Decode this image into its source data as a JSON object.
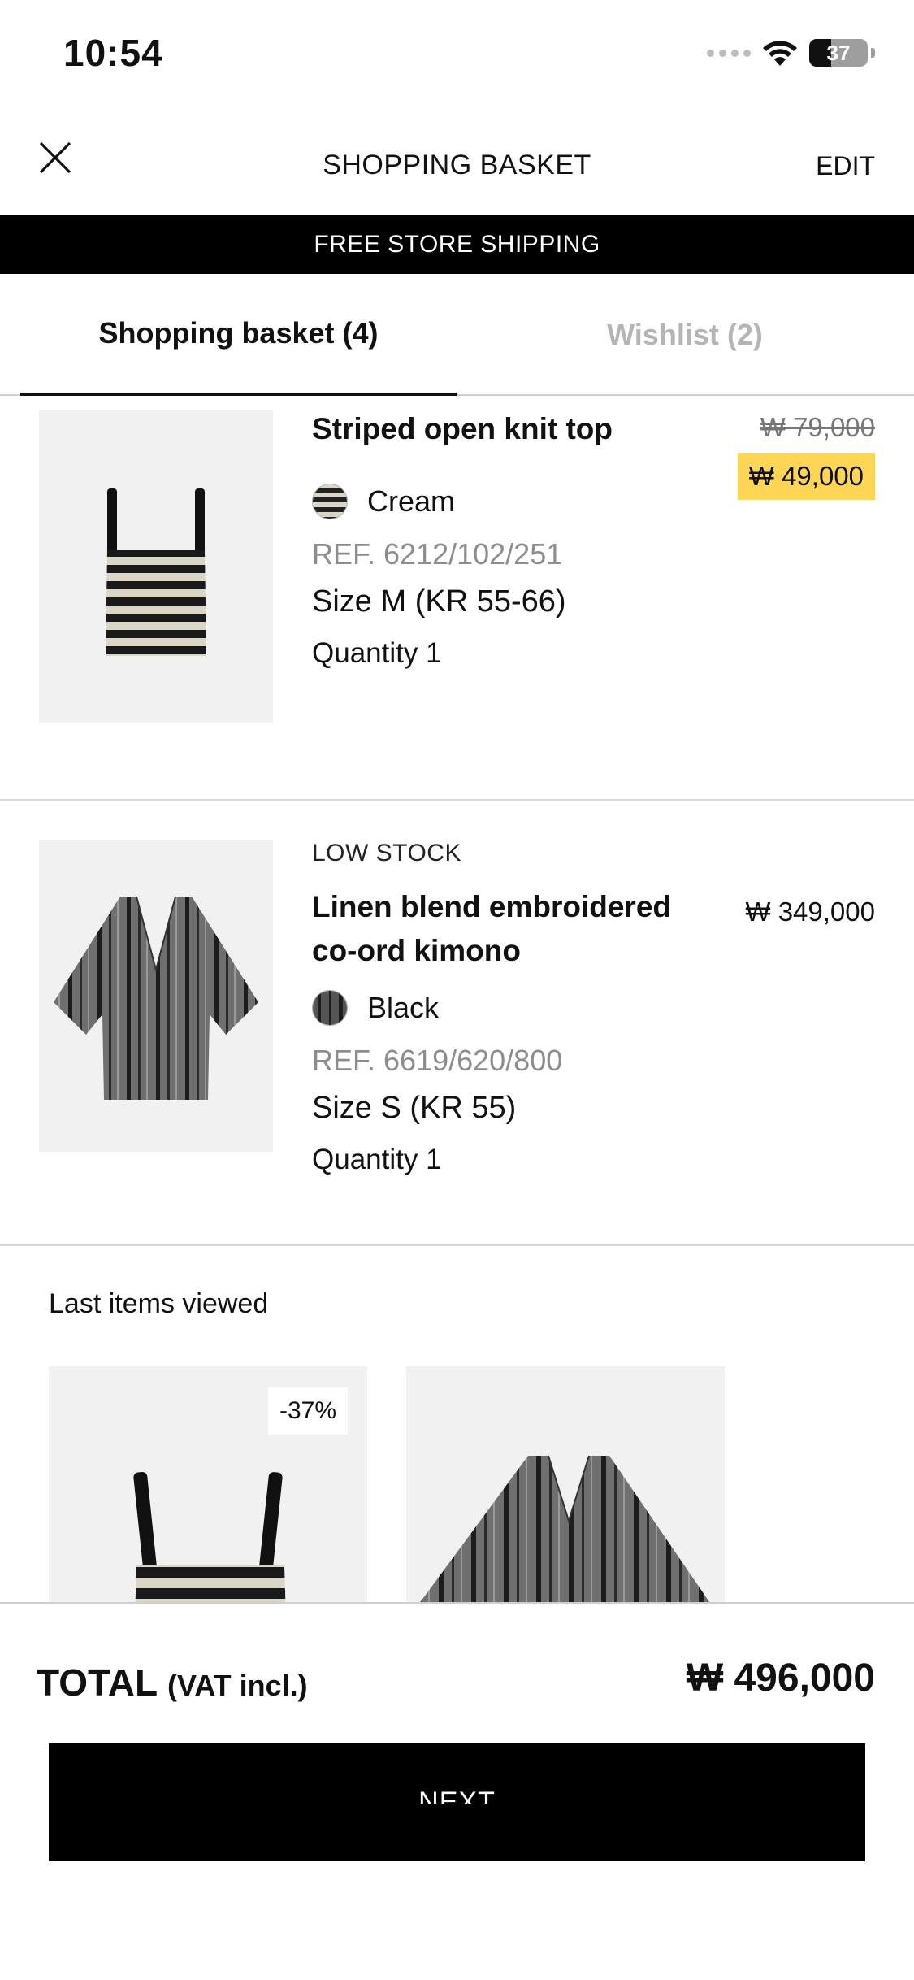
{
  "status_bar": {
    "time": "10:54",
    "battery": "37"
  },
  "header": {
    "title": "SHOPPING BASKET",
    "edit": "EDIT"
  },
  "banner": "FREE STORE SHIPPING",
  "tabs": [
    {
      "label": "Shopping basket (4)",
      "active": true
    },
    {
      "label": "Wishlist (2)",
      "active": false
    }
  ],
  "items": [
    {
      "name": "Striped open knit top",
      "old_price": "₩ 79,000",
      "price": "₩ 49,000",
      "color": "Cream",
      "ref": "REF. 6212/102/251",
      "size": "Size M (KR 55-66)",
      "quantity": "Quantity 1"
    },
    {
      "stock_label": "LOW STOCK",
      "name": "Linen blend embroidered co-ord kimono",
      "price": "₩ 349,000",
      "color": "Black",
      "ref": "REF. 6619/620/800",
      "size": "Size S (KR 55)",
      "quantity": "Quantity 1"
    }
  ],
  "recent": {
    "title": "Last items viewed",
    "cards": [
      {
        "badge": "-37%"
      },
      {
        "badge": ""
      }
    ]
  },
  "footer": {
    "total_label": "TOTAL",
    "vat_label": "(VAT incl.)",
    "total_value": "₩ 496,000",
    "next": "NEXT"
  },
  "colors": {
    "sale_highlight": "#ffd556",
    "primary": "#000000",
    "muted": "#8d8d8d"
  }
}
